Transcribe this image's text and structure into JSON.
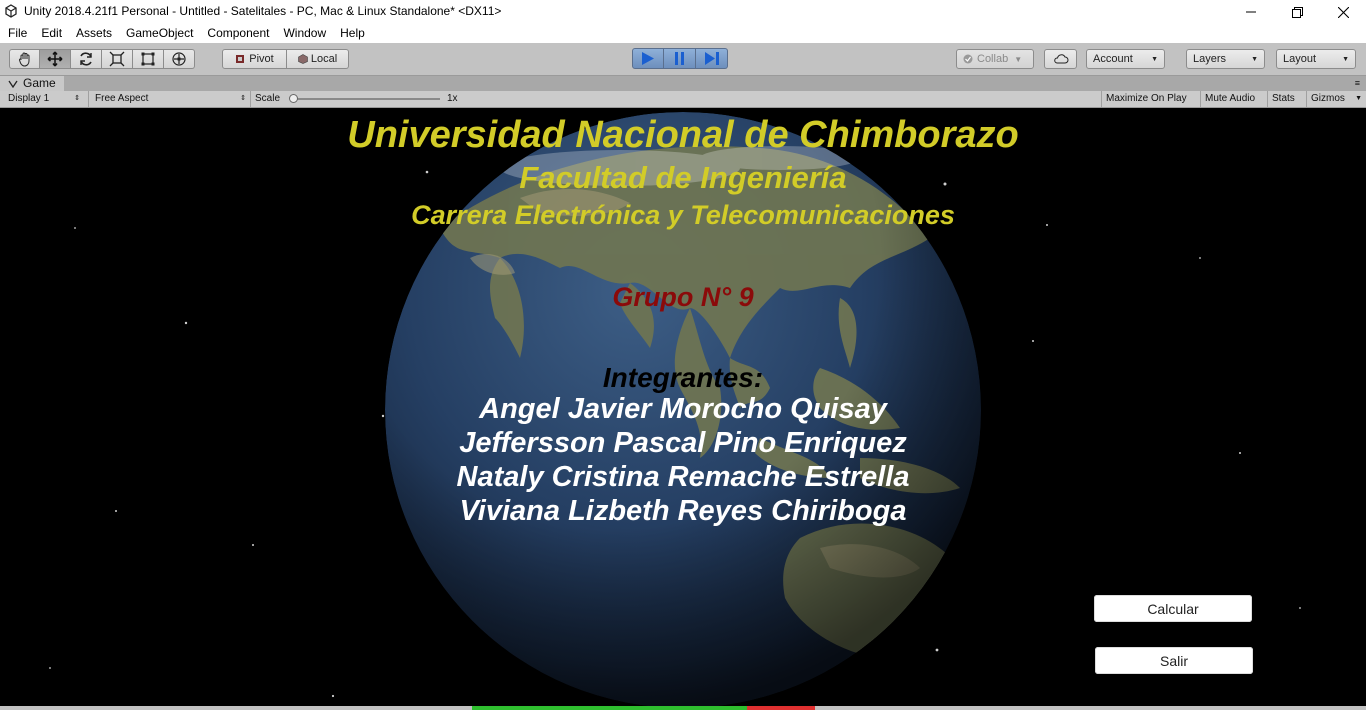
{
  "window": {
    "title": "Unity 2018.4.21f1 Personal - Untitled - Satelitales - PC, Mac & Linux Standalone* <DX11>"
  },
  "menu": [
    "File",
    "Edit",
    "Assets",
    "GameObject",
    "Component",
    "Window",
    "Help"
  ],
  "toolbar": {
    "pivot_label": "Pivot",
    "local_label": "Local",
    "collab_label": "Collab",
    "account_label": "Account",
    "layers_label": "Layers",
    "layout_label": "Layout"
  },
  "game_tab": {
    "tab_label": "Game",
    "display": "Display 1",
    "aspect": "Free Aspect",
    "scale_label": "Scale",
    "scale_value": "1x",
    "maximize": "Maximize On Play",
    "mute": "Mute Audio",
    "stats": "Stats",
    "gizmos": "Gizmos"
  },
  "scene": {
    "university": "Universidad Nacional de Chimborazo",
    "faculty": "Facultad de Ingeniería",
    "career": "Carrera Electrónica y Telecomunicaciones",
    "group": "Grupo N° 9",
    "members_heading": "Integrantes:",
    "members": [
      "Angel Javier Morocho Quisay",
      "Jeffersson Pascal Pino Enriquez",
      "Nataly Cristina Remache Estrella",
      "Viviana Lizbeth Reyes Chiriboga"
    ],
    "calc_button": "Calcular",
    "exit_button": "Salir"
  },
  "colors": {
    "title_yellow": "#d2cc28",
    "group_red": "#8b0a0a",
    "play_blue": "#2f6fd1"
  }
}
